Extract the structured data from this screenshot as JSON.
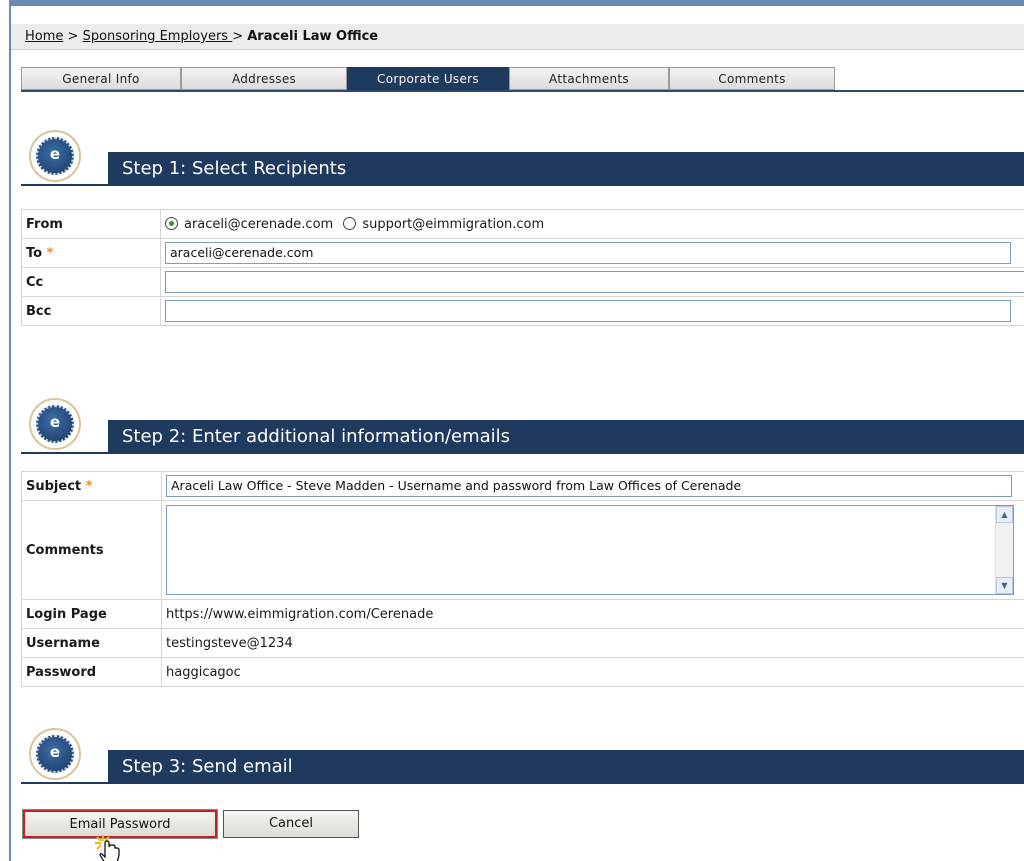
{
  "breadcrumb": {
    "home": "Home",
    "sep1": " > ",
    "employers": "Sponsoring Employers ",
    "sep2": " > ",
    "current": "Araceli Law Office"
  },
  "tabs": [
    "General Info",
    "Addresses",
    "Corporate Users",
    "Attachments",
    "Comments"
  ],
  "active_tab": "Corporate Users",
  "step1": {
    "title": "Step 1: Select Recipients",
    "from_label": "From",
    "from_options": [
      "araceli@cerenade.com",
      "support@eimmigration.com"
    ],
    "from_selected": "araceli@cerenade.com",
    "to_label": "To",
    "to_value": "araceli@cerenade.com",
    "cc_label": "Cc",
    "cc_value": "",
    "bcc_label": "Bcc",
    "bcc_value": ""
  },
  "step2": {
    "title": "Step 2: Enter additional information/emails",
    "subject_label": "Subject",
    "subject_value": "Araceli Law Office - Steve  Madden - Username and password from Law Offices of Cerenade",
    "comments_label": "Comments",
    "comments_value": "",
    "login_label": "Login Page",
    "login_value": "https://www.eimmigration.com/Cerenade",
    "username_label": "Username",
    "username_value": "testingsteve@1234",
    "password_label": "Password",
    "password_value": "haggicagoc"
  },
  "step3": {
    "title": "Step 3: Send email",
    "email_button": "Email Password",
    "cancel_button": "Cancel"
  },
  "required_mark": "*",
  "logo_letter": "e",
  "colors": {
    "header": "#1e3a5f",
    "required": "#f08a1a",
    "highlight": "#c02222",
    "radio_on": "#2f9a2f"
  }
}
